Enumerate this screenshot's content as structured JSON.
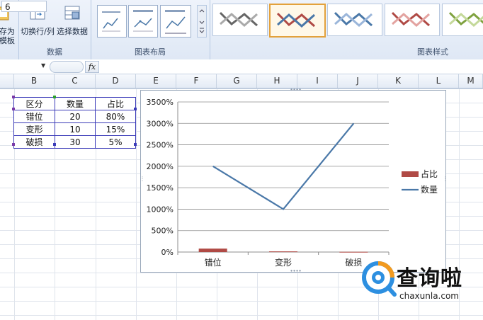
{
  "ribbon": {
    "save_template": {
      "line1": "存为",
      "line2": "模板"
    },
    "switch_row_col": "切换行/列",
    "select_data": "选择数据",
    "groups": {
      "data": "数据",
      "chart_layouts": "图表布局",
      "chart_styles": "图表样式"
    }
  },
  "formula_bar": {
    "name_box": "6",
    "fx_label": "fx",
    "content": ""
  },
  "columns": [
    "B",
    "C",
    "D",
    "E",
    "F",
    "G",
    "H",
    "I",
    "J",
    "K",
    "L",
    "M"
  ],
  "table": {
    "headers": [
      "区分",
      "数量",
      "占比"
    ],
    "rows": [
      [
        "错位",
        "20",
        "80%"
      ],
      [
        "变形",
        "10",
        "15%"
      ],
      [
        "破损",
        "30",
        "5%"
      ]
    ]
  },
  "colors": {
    "line_series": "#4a78a8",
    "bar_series": "#b04a45",
    "selection": "#3b3bb8",
    "accent_gold": "#e3a13b"
  },
  "chart_data": {
    "type": "line",
    "categories": [
      "错位",
      "变形",
      "破损"
    ],
    "series": [
      {
        "name": "占比",
        "kind": "bar",
        "values": [
          80,
          15,
          5
        ],
        "color": "#b04a45"
      },
      {
        "name": "数量",
        "kind": "line",
        "values": [
          2000,
          1000,
          3000
        ],
        "color": "#4a78a8"
      }
    ],
    "yticks": [
      "0%",
      "500%",
      "1000%",
      "1500%",
      "2000%",
      "2500%",
      "3000%",
      "3500%"
    ],
    "ylim": [
      0,
      3500
    ],
    "grid": true,
    "legend_position": "right",
    "title": "",
    "xlabel": "",
    "ylabel": ""
  },
  "watermark": {
    "text": "查询啦",
    "url": "chaxunla.com"
  }
}
